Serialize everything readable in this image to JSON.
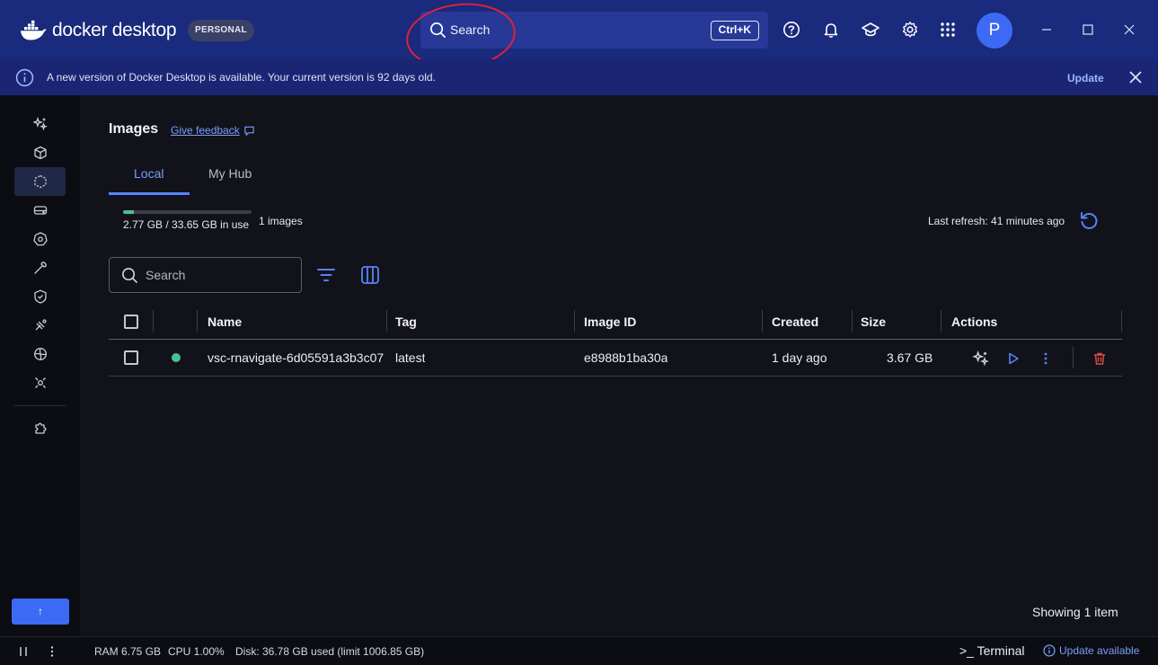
{
  "app": {
    "brand": "docker desktop",
    "plan_badge": "PERSONAL"
  },
  "topbar": {
    "search_label": "Search",
    "search_shortcut": "Ctrl+K",
    "avatar_initial": "P"
  },
  "banner": {
    "message": "A new version of Docker Desktop is available. Your current version is 92 days old.",
    "update_label": "Update"
  },
  "sidebar": {
    "items": [
      {
        "icon": "sparkles-icon"
      },
      {
        "icon": "containers-icon"
      },
      {
        "icon": "images-icon",
        "active": true
      },
      {
        "icon": "volumes-icon"
      },
      {
        "icon": "kubernetes-icon"
      },
      {
        "icon": "builds-icon"
      },
      {
        "icon": "scout-icon"
      },
      {
        "icon": "models-icon"
      },
      {
        "icon": "extensions-marketplace-icon"
      },
      {
        "icon": "mcp-toolkit-icon"
      },
      {
        "icon": "extensions-icon"
      }
    ],
    "bottom_button": "↑"
  },
  "page": {
    "title": "Images",
    "feedback": "Give feedback",
    "tabs": [
      {
        "label": "Local",
        "active": true
      },
      {
        "label": "My Hub"
      }
    ],
    "usage": {
      "text": "2.77 GB / 33.65 GB in use",
      "fraction": 0.082
    },
    "image_count": "1 images",
    "last_refresh": "Last refresh: 41 minutes ago",
    "search_placeholder": "Search"
  },
  "table": {
    "columns": [
      "Name",
      "Tag",
      "Image ID",
      "Created",
      "Size",
      "Actions"
    ],
    "rows": [
      {
        "name": "vsc-rnavigate-6d05591a3b3c07",
        "tag": "latest",
        "image_id": "e8988b1ba30a",
        "created": "1 day ago",
        "size": "3.67 GB",
        "status": "in-use"
      }
    ]
  },
  "showing": "Showing 1 item",
  "footer": {
    "ram": "RAM 6.75 GB",
    "cpu": "CPU 1.00%",
    "disk": "Disk: 36.78 GB used (limit 1006.85 GB)",
    "terminal": ">_ Terminal",
    "update_available": "Update available"
  },
  "colors": {
    "titlebar": "#1a2a7c",
    "accent": "#3d6af5",
    "link": "#7b9cff",
    "status_green": "#4ac08f",
    "delete_red": "#e04b4b"
  }
}
